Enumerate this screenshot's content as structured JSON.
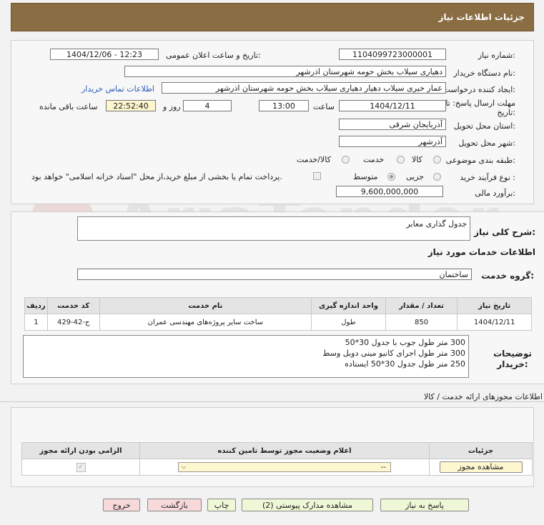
{
  "header": {
    "title": "جزئیات اطلاعات نیاز"
  },
  "fields": {
    "need_number_label": "شماره نیاز:",
    "need_number": "1104099723000001",
    "announce_label": "تاریخ و ساعت اعلان عمومی:",
    "announce_value": "1404/12/06 - 12:23",
    "buyer_org_label": "نام دستگاه خریدار:",
    "buyer_org": "دهیاری سیلاب بخش حومه شهرستان اذرشهر",
    "creator_label": "ایجاد کننده درخواست:",
    "creator": "عمار خیری سیلاب دهیار دهیاری سیلاب بخش حومه شهرستان اذرشهر",
    "contact_link": "اطلاعات تماس خریدار",
    "deadline_label": "مهلت ارسال پاسخ: تا تاریخ:",
    "deadline_date": "1404/12/11",
    "time_label": "ساعت",
    "deadline_time": "13:00",
    "days_value": "4",
    "days_label": "روز و",
    "remaining_value": "22:52:40",
    "remaining_label": "ساعت باقی مانده",
    "province_label": "استان محل تحویل:",
    "province": "آذربایجان شرقی",
    "city_label": "شهر محل تحویل:",
    "city": "آذرشهر",
    "category_label": "طبقه بندی موضوعی:",
    "category_options": [
      "کالا",
      "خدمت",
      "کالا/خدمت"
    ],
    "purchase_type_label": "نوع فرآیند خرید :",
    "purchase_options": [
      "جزیی",
      "متوسط"
    ],
    "payment_note": "پرداخت تمام یا بخشی از مبلغ خرید،از محل \"اسناد خزانه اسلامی\" خواهد بود.",
    "estimate_label": "برآورد مالی:",
    "estimate": "9,600,000,000"
  },
  "summary": {
    "label": "شرح کلی نیاز:",
    "value": "جدول گذاری معابر"
  },
  "services": {
    "section_title": "اطلاعات خدمات مورد نیاز",
    "group_label": "گروه خدمت:",
    "group_value": "ساختمان",
    "table": {
      "headers": [
        "ردیف",
        "کد خدمت",
        "نام خدمت",
        "واحد اندازه گیری",
        "تعداد / مقدار",
        "تاریخ نیاز"
      ],
      "rows": [
        [
          "1",
          "ج-42-429",
          "ساخت سایر پروژه‌های مهندسی عمران",
          "طول",
          "850",
          "1404/12/11"
        ]
      ]
    }
  },
  "buyer_notes": {
    "label": "توضیحات خریدار:",
    "lines": [
      "300 متر طول جوب با جدول 30*50",
      "300 متر طول اجرای کانیو مینی دوبل وسط",
      "250 متر طول جدول 30*50 ایستاده"
    ]
  },
  "permits": {
    "section_title": "اطلاعات مجوزهای ارائه خدمت / کالا",
    "headers": [
      "الزامی بودن ارائه مجوز",
      "اعلام وضعیت مجوز توسط تامین کننده",
      "جزئیات"
    ],
    "select_value": "--",
    "view_button": "مشاهده مجوز"
  },
  "actions": {
    "reply": "پاسخ به نیاز",
    "attachments": "مشاهده مدارک پیوستی (2)",
    "print": "چاپ",
    "back": "بازگشت",
    "exit": "خروج"
  },
  "colors": {
    "header": "#8a6d42",
    "button": "#eef7d6",
    "button_alt": "#f8d9d9",
    "link": "#2b5bb8"
  }
}
